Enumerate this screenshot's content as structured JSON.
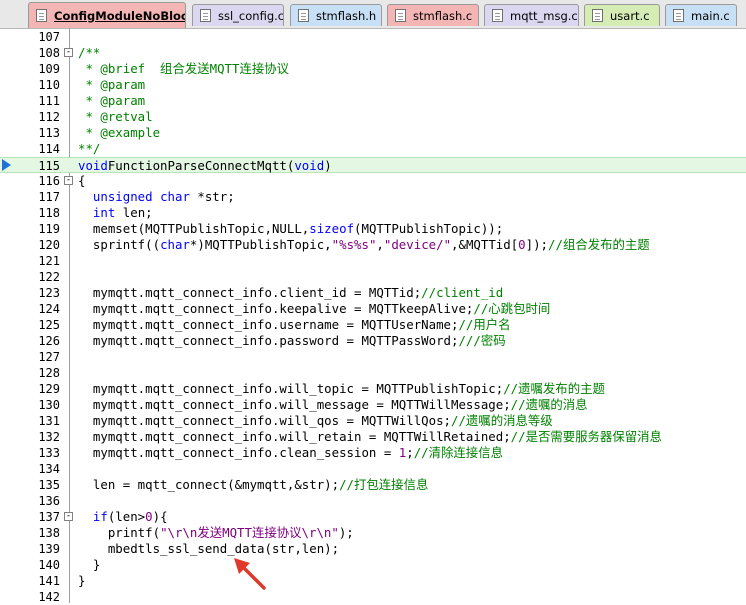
{
  "tabs": [
    {
      "label": "ConfigModuleNoBlock.c",
      "color": "#f4b5b5",
      "active": true
    },
    {
      "label": "ssl_config.c",
      "color": "#dcd7f0",
      "active": false
    },
    {
      "label": "stmflash.h",
      "color": "#c8e0f5",
      "active": false
    },
    {
      "label": "stmflash.c",
      "color": "#f4b5b5",
      "active": false
    },
    {
      "label": "mqtt_msg.c",
      "color": "#dcd7f0",
      "active": false
    },
    {
      "label": "usart.c",
      "color": "#d5ecb5",
      "active": false
    },
    {
      "label": "main.c",
      "color": "#c8e0f5",
      "active": false
    }
  ],
  "colors": {
    "keyword": "#0000ff",
    "comment": "#008000",
    "string": "#800080",
    "current_line": "#e3f7e3",
    "arrow": "#e0392b"
  },
  "current_line_number": "115",
  "lines": [
    {
      "n": "107",
      "segs": []
    },
    {
      "n": "108",
      "fold": "-",
      "segs": [
        [
          "cm",
          "/**"
        ]
      ]
    },
    {
      "n": "109",
      "segs": [
        [
          "cm",
          " * @brief  组合发送MQTT连接协议"
        ]
      ]
    },
    {
      "n": "110",
      "segs": [
        [
          "cm",
          " * @param"
        ]
      ]
    },
    {
      "n": "111",
      "segs": [
        [
          "cm",
          " * @param"
        ]
      ]
    },
    {
      "n": "112",
      "segs": [
        [
          "cm",
          " * @retval"
        ]
      ]
    },
    {
      "n": "113",
      "segs": [
        [
          "cm",
          " * @example"
        ]
      ]
    },
    {
      "n": "114",
      "segs": [
        [
          "cm",
          "**/"
        ]
      ]
    },
    {
      "n": "115",
      "current": true,
      "segs": [
        [
          "kw",
          "void"
        ],
        [
          "",
          "FunctionParseConnectMqtt("
        ],
        [
          "kw",
          "void"
        ],
        [
          "",
          ")"
        ]
      ]
    },
    {
      "n": "116",
      "fold": "-",
      "segs": [
        [
          "",
          "{"
        ]
      ]
    },
    {
      "n": "117",
      "segs": [
        [
          "",
          "  "
        ],
        [
          "kw",
          "unsigned"
        ],
        [
          "",
          " "
        ],
        [
          "kw",
          "char"
        ],
        [
          "",
          " *str;"
        ]
      ]
    },
    {
      "n": "118",
      "segs": [
        [
          "",
          "  "
        ],
        [
          "kw",
          "int"
        ],
        [
          "",
          " len;"
        ]
      ]
    },
    {
      "n": "119",
      "segs": [
        [
          "",
          "  memset(MQTTPublishTopic,NULL,"
        ],
        [
          "kw",
          "sizeof"
        ],
        [
          "",
          "(MQTTPublishTopic));"
        ]
      ]
    },
    {
      "n": "120",
      "segs": [
        [
          "",
          "  sprintf(("
        ],
        [
          "kw",
          "char"
        ],
        [
          "",
          "*)MQTTPublishTopic,"
        ],
        [
          "str",
          "\"%s%s\""
        ],
        [
          "",
          ","
        ],
        [
          "str",
          "\"device/\""
        ],
        [
          "",
          ",&MQTTid["
        ],
        [
          "num",
          "0"
        ],
        [
          "",
          "]);"
        ],
        [
          "cm",
          "//组合发布的主题"
        ]
      ]
    },
    {
      "n": "121",
      "segs": []
    },
    {
      "n": "122",
      "segs": []
    },
    {
      "n": "123",
      "segs": [
        [
          "",
          "  mymqtt.mqtt_connect_info.client_id = MQTTid;"
        ],
        [
          "cm",
          "//client_id"
        ]
      ]
    },
    {
      "n": "124",
      "segs": [
        [
          "",
          "  mymqtt.mqtt_connect_info.keepalive = MQTTkeepAlive;"
        ],
        [
          "cm",
          "//心跳包时间"
        ]
      ]
    },
    {
      "n": "125",
      "segs": [
        [
          "",
          "  mymqtt.mqtt_connect_info.username = MQTTUserName;"
        ],
        [
          "cm",
          "//用户名"
        ]
      ]
    },
    {
      "n": "126",
      "segs": [
        [
          "",
          "  mymqtt.mqtt_connect_info.password = MQTTPassWord;"
        ],
        [
          "cm",
          "///密码"
        ]
      ]
    },
    {
      "n": "127",
      "segs": []
    },
    {
      "n": "128",
      "segs": []
    },
    {
      "n": "129",
      "segs": [
        [
          "",
          "  mymqtt.mqtt_connect_info.will_topic = MQTTPublishTopic;"
        ],
        [
          "cm",
          "//遗嘱发布的主题"
        ]
      ]
    },
    {
      "n": "130",
      "segs": [
        [
          "",
          "  mymqtt.mqtt_connect_info.will_message = MQTTWillMessage;"
        ],
        [
          "cm",
          "//遗嘱的消息"
        ]
      ]
    },
    {
      "n": "131",
      "segs": [
        [
          "",
          "  mymqtt.mqtt_connect_info.will_qos = MQTTWillQos;"
        ],
        [
          "cm",
          "//遗嘱的消息等级"
        ]
      ]
    },
    {
      "n": "132",
      "segs": [
        [
          "",
          "  mymqtt.mqtt_connect_info.will_retain = MQTTWillRetained;"
        ],
        [
          "cm",
          "//是否需要服务器保留消息"
        ]
      ]
    },
    {
      "n": "133",
      "segs": [
        [
          "",
          "  mymqtt.mqtt_connect_info.clean_session = "
        ],
        [
          "num",
          "1"
        ],
        [
          "",
          ";"
        ],
        [
          "cm",
          "//清除连接信息"
        ]
      ]
    },
    {
      "n": "134",
      "segs": []
    },
    {
      "n": "135",
      "segs": [
        [
          "",
          "  len = mqtt_connect(&mymqtt,&str);"
        ],
        [
          "cm",
          "//打包连接信息"
        ]
      ]
    },
    {
      "n": "136",
      "segs": []
    },
    {
      "n": "137",
      "fold": "-",
      "segs": [
        [
          "",
          "  "
        ],
        [
          "kw",
          "if"
        ],
        [
          "",
          "(len>"
        ],
        [
          "num",
          "0"
        ],
        [
          "",
          "){"
        ]
      ]
    },
    {
      "n": "138",
      "segs": [
        [
          "",
          "    printf("
        ],
        [
          "str",
          "\"\\r\\n发送MQTT连接协议\\r\\n\""
        ],
        [
          "",
          ");"
        ]
      ]
    },
    {
      "n": "139",
      "segs": [
        [
          "",
          "    mbedtls_ssl_send_data(str,len);"
        ]
      ]
    },
    {
      "n": "140",
      "segs": [
        [
          "",
          "  }"
        ]
      ]
    },
    {
      "n": "141",
      "segs": [
        [
          "",
          "}"
        ]
      ]
    },
    {
      "n": "142",
      "segs": []
    }
  ]
}
